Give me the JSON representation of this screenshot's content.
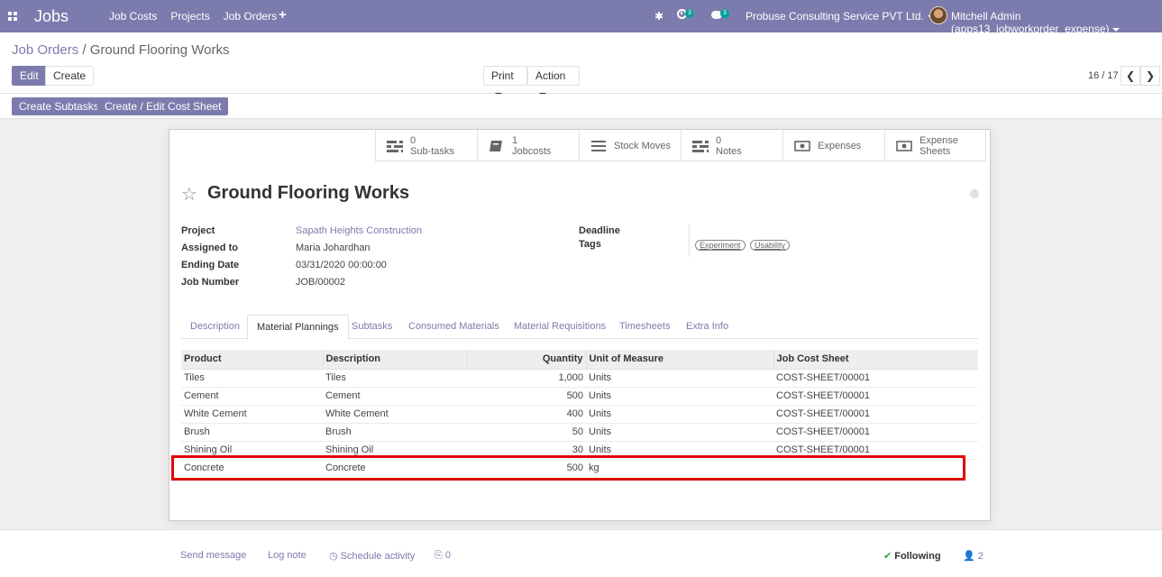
{
  "app": {
    "brand": "Jobs",
    "menu": [
      "Job Costs",
      "Projects",
      "Job Orders"
    ],
    "plus_label": "+",
    "activity_count": "3",
    "message_count": "3",
    "company": "Probuse Consulting Service PVT Ltd.",
    "user": "Mitchell Admin (apps13_jobworkorder_expense)"
  },
  "breadcrumb": {
    "parent": "Job Orders",
    "separator": " / ",
    "current": "Ground Flooring Works"
  },
  "toolbar": {
    "edit_label": "Edit",
    "create_label": "Create",
    "print_label": "Print",
    "action_label": "Action",
    "pager_value": "16 / 17",
    "prev_label": "❮",
    "next_label": "❯"
  },
  "header_buttons": {
    "create_subtasks": "Create Subtasks",
    "cost_sheet": "Create / Edit Cost Sheet"
  },
  "smart_buttons": [
    {
      "count": "0",
      "label": "Sub-tasks",
      "icon": "tasks-icon"
    },
    {
      "count": "1",
      "label": "Jobcosts",
      "icon": "book-icon"
    },
    {
      "count": "",
      "label": "Stock Moves",
      "icon": "list-icon"
    },
    {
      "count": "0",
      "label": "Notes",
      "icon": "tasks-icon"
    },
    {
      "count": "",
      "label": "Expenses",
      "icon": "money-icon"
    },
    {
      "count": "Expense",
      "label": "Sheets",
      "icon": "money-icon"
    }
  ],
  "record": {
    "star": "☆",
    "title": "Ground Flooring Works",
    "fields": {
      "project_label": "Project",
      "project_value": "Sapath Heights Construction",
      "assigned_label": "Assigned to",
      "assigned_value": "Maria Johardhan",
      "ending_label": "Ending Date",
      "ending_value": "03/31/2020 00:00:00",
      "jobnum_label": "Job Number",
      "jobnum_value": "JOB/00002",
      "deadline_label": "Deadline",
      "tags_label": "Tags"
    },
    "tags": [
      "Experiment",
      "Usability"
    ]
  },
  "tabs": [
    "Description",
    "Material Plannings",
    "Subtasks",
    "Consumed Materials",
    "Material Requisitions",
    "Timesheets",
    "Extra Info"
  ],
  "table": {
    "headers": [
      "Product",
      "Description",
      "Quantity",
      "Unit of Measure",
      "Job Cost Sheet"
    ],
    "rows": [
      [
        "Tiles",
        "Tiles",
        "1,000",
        "Units",
        "COST-SHEET/00001"
      ],
      [
        "Cement",
        "Cement",
        "500",
        "Units",
        "COST-SHEET/00001"
      ],
      [
        "White Cement",
        "White Cement",
        "400",
        "Units",
        "COST-SHEET/00001"
      ],
      [
        "Brush",
        "Brush",
        "50",
        "Units",
        "COST-SHEET/00001"
      ],
      [
        "Shining Oil",
        "Shining Oil",
        "30",
        "Units",
        "COST-SHEET/00001"
      ],
      [
        "Concrete",
        "Concrete",
        "500",
        "kg",
        ""
      ]
    ]
  },
  "chatter": {
    "send_message": "Send message",
    "log_note": "Log note",
    "schedule_activity": "Schedule activity",
    "attachments": "0",
    "following": "Following",
    "followers": "2"
  },
  "colors": {
    "brand": "#7c7bad",
    "highlight": "#e00000",
    "success": "#28a745"
  }
}
